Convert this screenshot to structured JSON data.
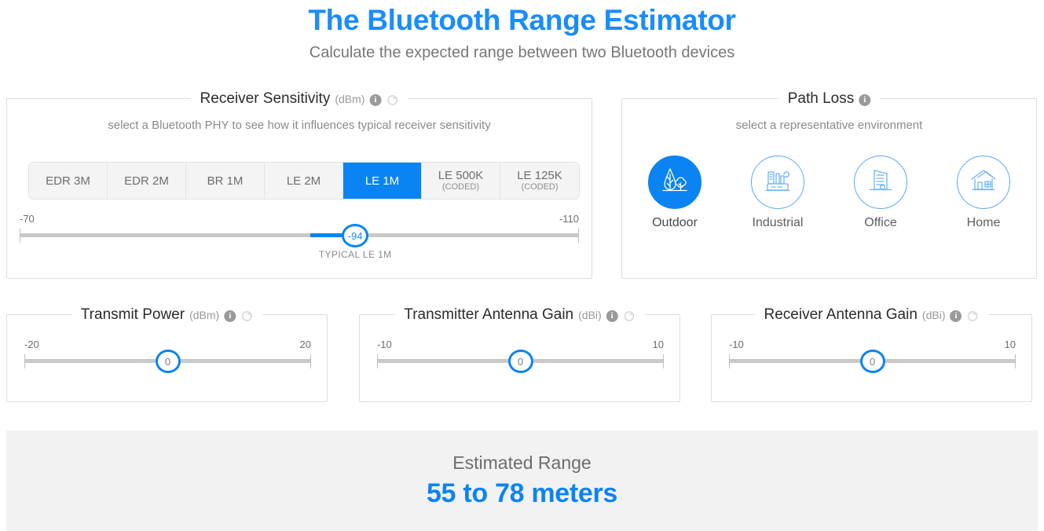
{
  "header": {
    "title": "The Bluetooth Range Estimator",
    "subtitle": "Calculate the expected range between two Bluetooth devices"
  },
  "colors": {
    "accent_blue": "#0b84f3",
    "title_blue": "#1a8cff",
    "icon_blue_light": "#59a9f7",
    "track_gray": "#c9c9c9",
    "panel_border": "#dddddd",
    "footer_bg": "#f2f2f2",
    "segment_bg": "#f4f4f4"
  },
  "receiver_sensitivity": {
    "legend": "Receiver Sensitivity",
    "unit": "(dBm)",
    "info_icon": "info-icon",
    "reset_icon": "reset-icon",
    "hint": "select a Bluetooth PHY to see how it influences typical receiver sensitivity",
    "phy_options": [
      {
        "main": "EDR 3M",
        "sub": "",
        "selected": false
      },
      {
        "main": "EDR 2M",
        "sub": "",
        "selected": false
      },
      {
        "main": "BR 1M",
        "sub": "",
        "selected": false
      },
      {
        "main": "LE 2M",
        "sub": "",
        "selected": false
      },
      {
        "main": "LE 1M",
        "sub": "",
        "selected": true
      },
      {
        "main": "LE 500K",
        "sub": "(CODED)",
        "selected": false
      },
      {
        "main": "LE 125K",
        "sub": "(CODED)",
        "selected": false
      }
    ],
    "slider": {
      "min_label": "-70",
      "max_label": "-110",
      "value": "-94",
      "note": "TYPICAL LE 1M",
      "handle_percent": 60
    }
  },
  "path_loss": {
    "legend": "Path Loss",
    "unit": "",
    "info_icon": "info-icon",
    "hint": "select a representative environment",
    "environments": [
      {
        "label": "Outdoor",
        "icon": "trees-icon",
        "selected": true
      },
      {
        "label": "Industrial",
        "icon": "factory-icon",
        "selected": false
      },
      {
        "label": "Office",
        "icon": "office-building-icon",
        "selected": false
      },
      {
        "label": "Home",
        "icon": "house-icon",
        "selected": false
      }
    ]
  },
  "transmit_power": {
    "legend": "Transmit Power",
    "unit": "(dBm)",
    "info_icon": "info-icon",
    "reset_icon": "reset-icon",
    "slider": {
      "min_label": "-20",
      "max_label": "20",
      "value": "0",
      "handle_percent": 50
    }
  },
  "transmitter_antenna_gain": {
    "legend": "Transmitter Antenna Gain",
    "unit": "(dBi)",
    "info_icon": "info-icon",
    "reset_icon": "reset-icon",
    "slider": {
      "min_label": "-10",
      "max_label": "10",
      "value": "0",
      "handle_percent": 50
    }
  },
  "receiver_antenna_gain": {
    "legend": "Receiver Antenna Gain",
    "unit": "(dBi)",
    "info_icon": "info-icon",
    "reset_icon": "reset-icon",
    "slider": {
      "min_label": "-10",
      "max_label": "10",
      "value": "0",
      "handle_percent": 50
    }
  },
  "result": {
    "label": "Estimated Range",
    "value": "55 to 78 meters"
  }
}
